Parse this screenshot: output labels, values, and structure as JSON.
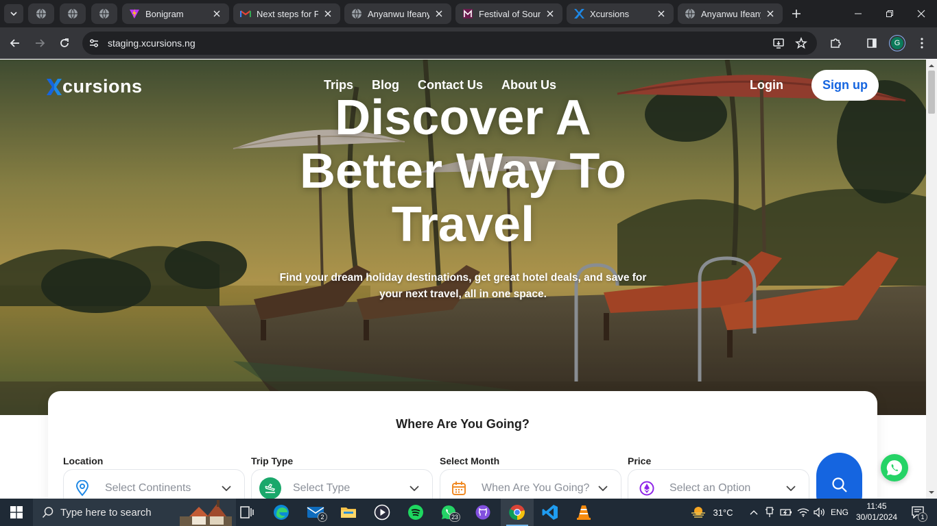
{
  "browser": {
    "tabs": [
      {
        "title": "",
        "icon": "globe-icon",
        "pinned": true
      },
      {
        "title": "",
        "icon": "globe-icon",
        "pinned": true
      },
      {
        "title": "",
        "icon": "globe-icon",
        "pinned": true
      },
      {
        "title": "Bonigram",
        "icon": "vite-icon"
      },
      {
        "title": "Next steps for Fu",
        "icon": "gmail-icon"
      },
      {
        "title": "Anyanwu Ifeanyi",
        "icon": "globe-icon"
      },
      {
        "title": "Festival of Sound",
        "icon": "festival-icon"
      },
      {
        "title": "Xcursions",
        "icon": "xcursions-icon",
        "active": true
      },
      {
        "title": "Anyanwu Ifeanyi",
        "icon": "globe-icon"
      }
    ],
    "url": "staging.xcursions.ng",
    "profile_initial": "G"
  },
  "site": {
    "logo_text": "cursions",
    "nav": [
      "Trips",
      "Blog",
      "Contact Us",
      "About Us"
    ],
    "login_label": "Login",
    "signup_label": "Sign up",
    "headline": [
      "Discover A",
      "Better Way To",
      "Travel"
    ],
    "subheadline": "Find your dream holiday destinations, get great hotel deals, and save for your next travel, all in one space.",
    "search_card": {
      "title": "Where Are You Going?",
      "fields": [
        {
          "label": "Location",
          "placeholder": "Select Continents",
          "icon": "location-pin-icon"
        },
        {
          "label": "Trip Type",
          "placeholder": "Select Type",
          "icon": "plane-landing-icon"
        },
        {
          "label": "Select Month",
          "placeholder": "When Are You Going?",
          "icon": "calendar-icon"
        },
        {
          "label": "Price",
          "placeholder": "Select an Option",
          "icon": "currency-icon"
        }
      ]
    }
  },
  "taskbar": {
    "search_placeholder": "Type here to search",
    "mail_badge": "2",
    "whatsapp_badge": "23",
    "weather": "31°C",
    "language": "ENG",
    "time": "11:45",
    "date": "30/01/2024",
    "notification_count": "1"
  },
  "colors": {
    "brand_blue": "#1565e0",
    "chrome_dark": "#202124",
    "chrome_toolbar": "#35363a",
    "taskbar": "#1f2a36",
    "whatsapp_green": "#25d366"
  }
}
